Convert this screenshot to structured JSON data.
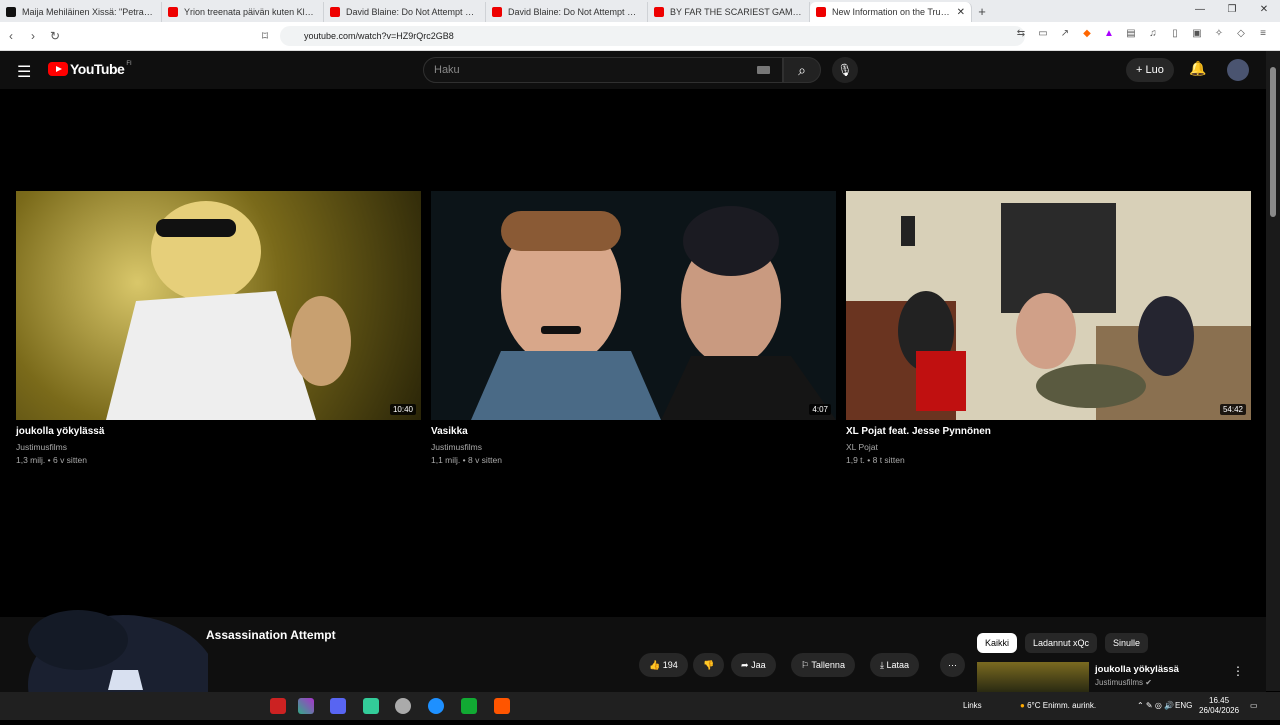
{
  "browser": {
    "tabs": [
      {
        "title": "Maija Mehiläinen Xissä: \"Petra Nyqvi",
        "favicon": "x"
      },
      {
        "title": "Yrion treenata päivän kuten Klaebo - ",
        "favicon": "yt"
      },
      {
        "title": "David Blaine: Do Not Attempt MEGA",
        "favicon": "yt"
      },
      {
        "title": "David Blaine: Do Not Attempt MEGA",
        "favicon": "yt"
      },
      {
        "title": "BY FAR THE SCARIEST GAME OF THE",
        "favicon": "yt"
      },
      {
        "title": "New Information on the Trump A",
        "favicon": "yt",
        "active": true
      }
    ],
    "url": "youtube.com/watch?v=HZ9rQrc2GB8"
  },
  "header": {
    "logo_text": "YouTube",
    "region": "FI",
    "search_placeholder": "Haku",
    "create_label": "Luo"
  },
  "videos": [
    {
      "title": "joukolla yökylässä",
      "channel": "Justimusfilms",
      "stats": "1,3 milj. • 6 v sitten",
      "duration": "10:40"
    },
    {
      "title": "Vasikka",
      "channel": "Justimusfilms",
      "stats": "1,1 milj. • 8 v sitten",
      "duration": "4:07"
    },
    {
      "title": "XL Pojat feat. Jesse Pynnönen",
      "channel": "XL Pojat",
      "stats": "1,9 t. • 8 t sitten",
      "duration": "54:42"
    }
  ],
  "player": {
    "title": "Assassination Attempt",
    "likes": "194",
    "share_label": "Jaa",
    "save_label": "Tallenna",
    "download_label": "Lataa"
  },
  "sidebar": {
    "chips": [
      "Kaikki",
      "Ladannut xQc",
      "Sinulle"
    ],
    "next_title": "joukolla yökylässä",
    "next_channel": "Justimusfilms"
  },
  "taskbar": {
    "links": "Links",
    "weather": "6°C  Enimm. aurink.",
    "lang": "ENG",
    "time": "16.45",
    "date": "26/04/2026"
  },
  "colors": {
    "accent": "#ff0000",
    "bg": "#0f0f0f"
  }
}
